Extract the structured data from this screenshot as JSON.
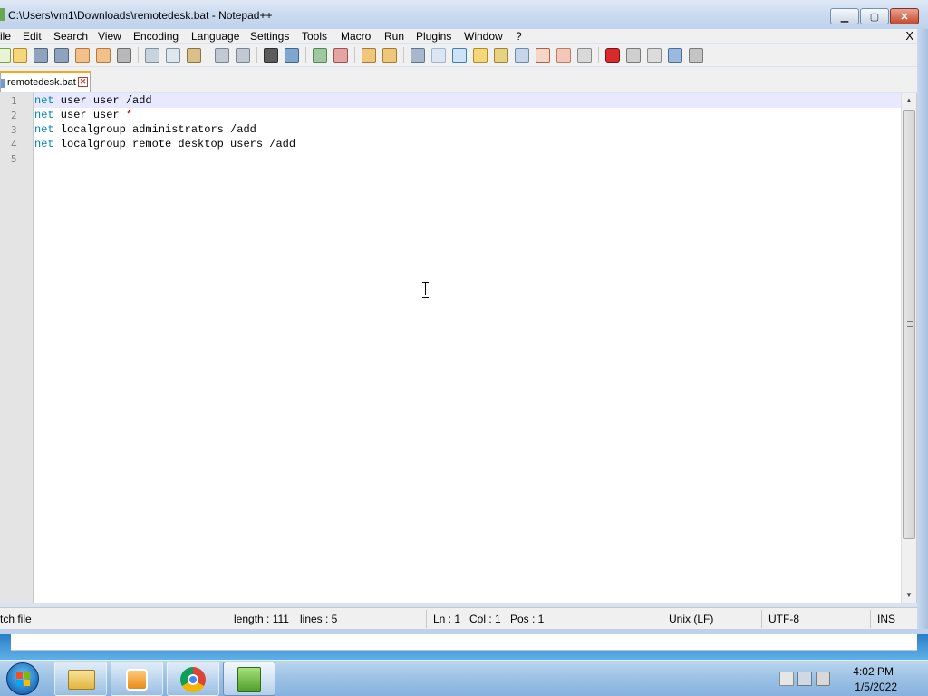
{
  "window": {
    "title": "C:\\Users\\vm1\\Downloads\\remotedesk.bat - Notepad++",
    "minimize_label": "▁",
    "maximize_label": "▢",
    "close_label": "✕"
  },
  "menu": {
    "items": [
      "ile",
      "Edit",
      "Search",
      "View",
      "Encoding",
      "Language",
      "Settings",
      "Tools",
      "Macro",
      "Run",
      "Plugins",
      "Window",
      "?"
    ],
    "close_doc": "X"
  },
  "toolbar": {
    "icons": [
      "new-file-icon",
      "open-file-icon",
      "save-icon",
      "save-all-icon",
      "close-icon",
      "close-all-icon",
      "print-icon",
      "cut-icon",
      "copy-icon",
      "paste-icon",
      "undo-icon",
      "redo-icon",
      "find-icon",
      "replace-icon",
      "zoom-in-icon",
      "zoom-out-icon",
      "sync-vertical-icon",
      "sync-horizontal-icon",
      "word-wrap-icon",
      "show-all-chars-icon",
      "indent-guide-icon",
      "user-lang-icon",
      "doc-map-icon",
      "doc-list-icon",
      "function-list-icon",
      "folder-workspace-icon",
      "monitoring-icon",
      "record-macro-icon",
      "stop-record-icon",
      "play-macro-icon",
      "run-macro-multiple-icon",
      "save-macro-icon"
    ]
  },
  "tab": {
    "label": "remotedesk.bat",
    "close": "✕"
  },
  "editor": {
    "lines": [
      {
        "no": "1",
        "kw": "net",
        "text": " user user /add",
        "op": ""
      },
      {
        "no": "2",
        "kw": "net",
        "text": " user user ",
        "op": "*"
      },
      {
        "no": "3",
        "kw": "net",
        "text": " localgroup administrators /add",
        "op": ""
      },
      {
        "no": "4",
        "kw": "net",
        "text": " localgroup remote desktop users /add",
        "op": ""
      },
      {
        "no": "5",
        "kw": "",
        "text": "",
        "op": ""
      }
    ]
  },
  "status": {
    "file_type": "tch file",
    "length": "length : 111",
    "lines": "lines : 5",
    "ln": "Ln : 1",
    "col": "Col : 1",
    "pos": "Pos : 1",
    "eol": "Unix (LF)",
    "encoding": "UTF-8",
    "mode": "INS"
  },
  "taskbar": {
    "apps": [
      "explorer-icon",
      "media-player-icon",
      "chrome-icon",
      "notepad-plus-plus-icon"
    ],
    "time": "4:02 PM",
    "date": "1/5/2022"
  },
  "colors": {
    "keyword": "#0080c0",
    "operator": "#ff0000",
    "current_line": "#e8e8ff"
  }
}
